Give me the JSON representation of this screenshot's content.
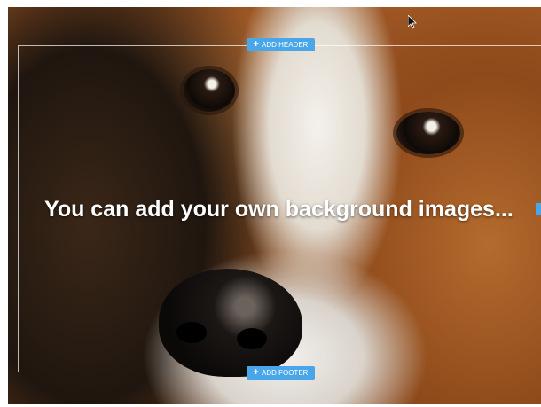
{
  "editor": {
    "header_button_label": "ADD HEADER",
    "footer_button_label": "ADD FOOTER",
    "heading_text": "You can add your own background images...",
    "accent_color": "#49a6e9"
  },
  "icons": {
    "add_header": "plus-icon",
    "add_footer": "plus-icon",
    "pointer": "mouse-cursor-icon"
  }
}
